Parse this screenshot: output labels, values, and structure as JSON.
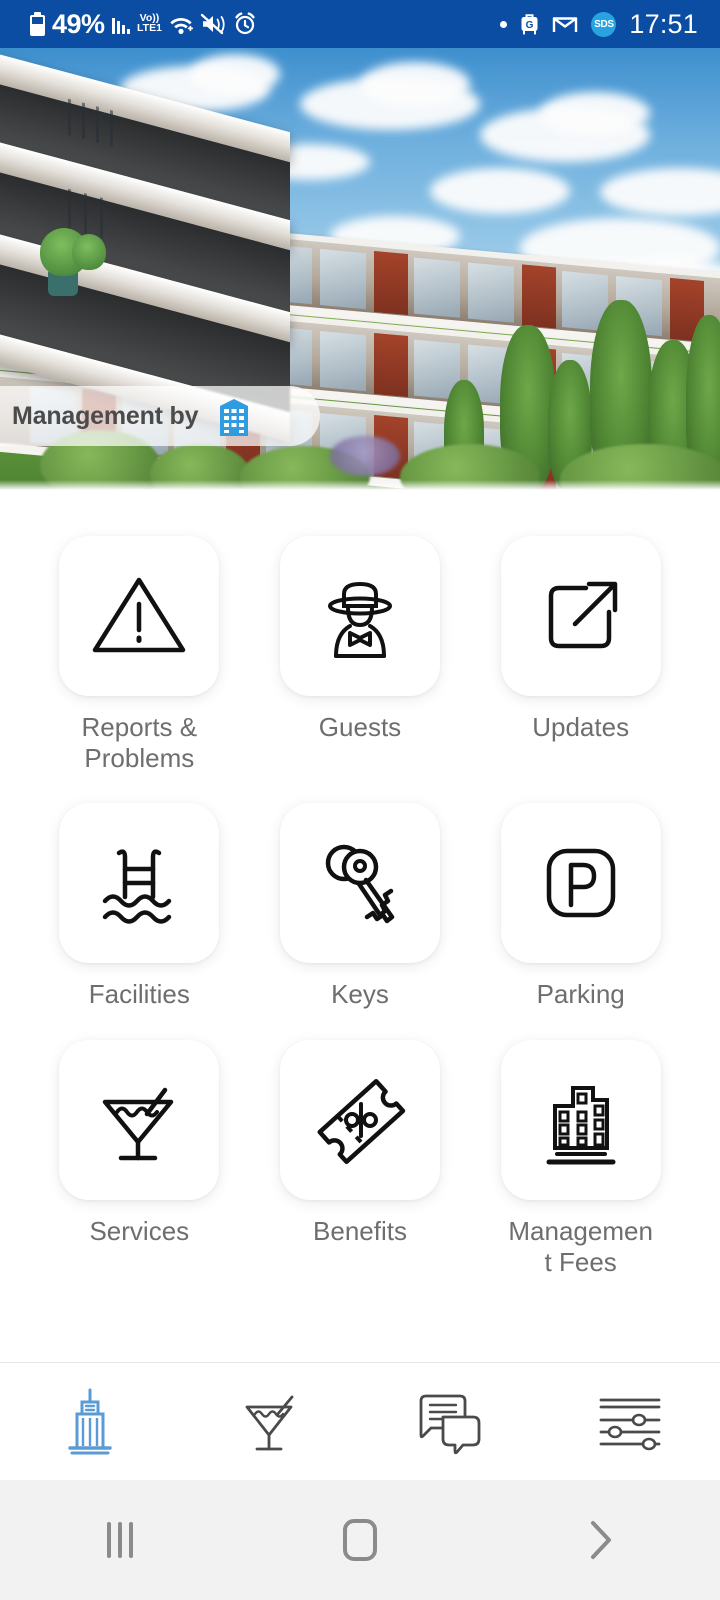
{
  "statusbar": {
    "battery_percent": "49%",
    "network_type_top": "Vo))",
    "network_type_bottom": "LTE1",
    "sds_badge": "SDS",
    "clock": "17:51",
    "icons": [
      "battery-icon",
      "signal-bars-icon",
      "volte-icon",
      "wifi-icon",
      "vibrate-icon",
      "alarm-icon",
      "dot-icon",
      "gpay-icon",
      "gmail-icon",
      "sds-icon"
    ],
    "background_color": "#0b4da2",
    "foreground_color": "#ffffff"
  },
  "hero": {
    "overlay_text": "Management by",
    "logo_name": "building-logo",
    "logo_color": "#2f9be0",
    "alt": "Modern apartment building exterior with green landscaping"
  },
  "grid": {
    "items": [
      {
        "label": "Reports & Problems",
        "icon": "warning-triangle-icon"
      },
      {
        "label": "Guests",
        "icon": "person-with-hat-icon"
      },
      {
        "label": "Updates",
        "icon": "external-link-icon"
      },
      {
        "label": "Facilities",
        "icon": "pool-ladder-icon"
      },
      {
        "label": "Keys",
        "icon": "keys-icon"
      },
      {
        "label": "Parking",
        "icon": "parking-p-icon"
      },
      {
        "label": "Services",
        "icon": "cocktail-glass-icon"
      },
      {
        "label": "Benefits",
        "icon": "discount-ticket-icon"
      },
      {
        "label": "Management Fees",
        "icon": "building-fees-icon"
      }
    ],
    "label_color": "#6e6e6e",
    "tile_color": "#ffffff"
  },
  "bottomnav": {
    "items": [
      {
        "name": "building-tab",
        "icon": "building-tower-icon",
        "active": true
      },
      {
        "name": "services-tab",
        "icon": "cocktail-glass-icon",
        "active": false
      },
      {
        "name": "messages-tab",
        "icon": "chat-bubbles-icon",
        "active": false
      },
      {
        "name": "settings-tab",
        "icon": "sliders-icon",
        "active": false
      }
    ],
    "active_color": "#5b9bd5",
    "inactive_color": "#4a4a4a"
  },
  "sysnav": {
    "buttons": [
      {
        "name": "recents-button",
        "icon": "recents-icon"
      },
      {
        "name": "home-button",
        "icon": "home-icon"
      },
      {
        "name": "back-button",
        "icon": "back-chevron-icon"
      }
    ],
    "color": "#8b8b8b",
    "background_color": "#f2f2f2"
  }
}
